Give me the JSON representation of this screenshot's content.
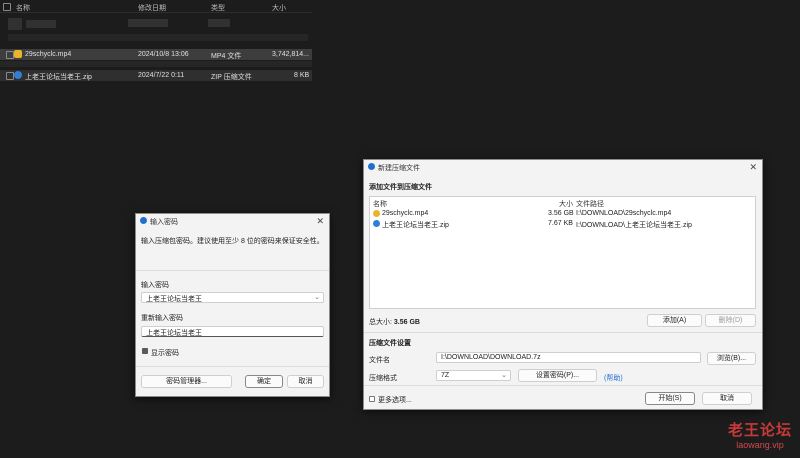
{
  "explorer": {
    "columns": [
      "名称",
      "修改日期",
      "类型",
      "大小"
    ],
    "rows": [
      {
        "name": "29schyclc.mp4",
        "date": "2024/10/8 13:06",
        "type": "MP4 文件",
        "size": "3,742,814..."
      },
      {
        "name": "上老王论坛当老王.zip",
        "date": "2024/7/22 0:11",
        "type": "ZIP 压缩文件",
        "size": "8 KB"
      }
    ]
  },
  "password_dialog": {
    "title": "输入密码",
    "close": "✕",
    "hint": "输入压缩包密码。建议使用至少 8 位的密码来保证安全性。",
    "pwd_label": "输入密码",
    "pwd_value": "上老王论坛当老王",
    "confirm_label": "重新输入密码",
    "confirm_value": "上老王论坛当老王",
    "show_pwd": "显示密码",
    "manager_btn": "密码管理器...",
    "ok_btn": "确定",
    "cancel_btn": "取消"
  },
  "archive_dialog": {
    "title": "新建压缩文件",
    "close": "✕",
    "section_add": "添加文件到压缩文件",
    "list_headers": {
      "name": "名称",
      "size": "大小",
      "path": "文件路径"
    },
    "files": [
      {
        "name": "29schyclc.mp4",
        "size": "3.56 GB",
        "path": "I:\\DOWNLOAD\\29schyclc.mp4"
      },
      {
        "name": "上老王论坛当老王.zip",
        "size": "7.67 KB",
        "path": "I:\\DOWNLOAD\\上老王论坛当老王.zip"
      }
    ],
    "total_label": "总大小:",
    "total_value": "3.56 GB",
    "add_btn": "添加(A)",
    "delete_btn": "删除(D)",
    "section_settings": "压缩文件设置",
    "filename_label": "文件名",
    "filename_value": "I:\\DOWNLOAD\\DOWNLOAD.7z",
    "browse_btn": "浏览(B)...",
    "format_label": "压缩格式",
    "format_value": "7Z",
    "setpwd_btn": "设置密码(P)...",
    "help_link": "(帮助)",
    "more_options": "更多选项...",
    "start_btn": "开始(S)",
    "cancel_btn": "取消"
  },
  "watermark": {
    "line1": "老王论坛",
    "line2": "laowang.vip"
  },
  "colors": {
    "accent": "#1f6fd1",
    "mp4_icon": "#e8b42a",
    "zip_icon": "#2f7fd6",
    "watermark": "#c83a3a"
  }
}
